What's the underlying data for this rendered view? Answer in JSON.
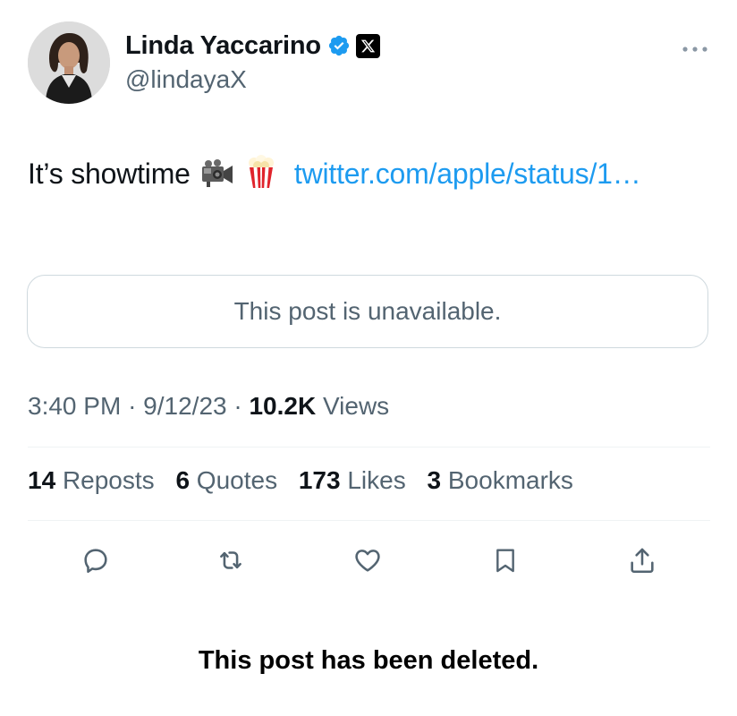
{
  "author": {
    "display_name": "Linda Yaccarino",
    "handle": "@lindayaX",
    "verified": true,
    "verified_color": "#1d9bf0",
    "affiliation_badge": "x-logo-icon"
  },
  "post": {
    "text": "It’s showtime",
    "emojis": [
      "movie-camera-icon",
      "popcorn-icon"
    ],
    "link_text": "twitter.com/apple/status/1…",
    "link_color": "#1d9bf0",
    "embedded_notice": "This post is unavailable."
  },
  "meta": {
    "time": "3:40 PM",
    "separator": "·",
    "date": "9/12/23",
    "views_count": "10.2K",
    "views_label": "Views"
  },
  "stats": [
    {
      "count": "14",
      "label": "Reposts"
    },
    {
      "count": "6",
      "label": "Quotes"
    },
    {
      "count": "173",
      "label": "Likes"
    },
    {
      "count": "3",
      "label": "Bookmarks"
    }
  ],
  "actions": [
    "reply-icon",
    "repost-icon",
    "like-icon",
    "bookmark-icon",
    "share-icon"
  ],
  "footer": {
    "deleted_notice": "This post has been deleted."
  }
}
